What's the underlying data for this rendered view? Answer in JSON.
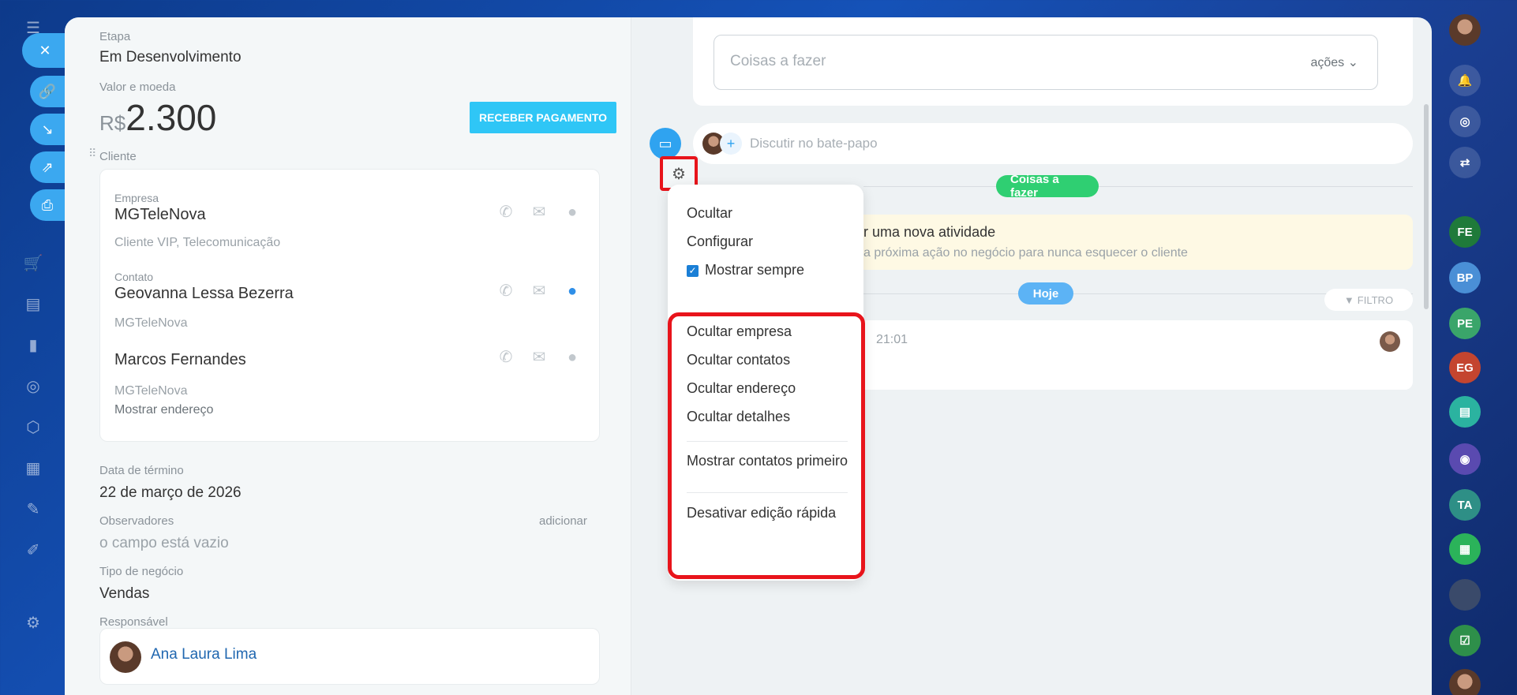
{
  "left_panel": {
    "stage_label": "Etapa",
    "stage_value": "Em Desenvolvimento",
    "amount_label": "Valor e moeda",
    "currency": "R$",
    "amount": "2.300",
    "pay_button": "RECEBER PAGAMENTO",
    "client_label": "Cliente",
    "client": {
      "company_label": "Empresa",
      "company_name": "MGTeleNova",
      "company_sub": "Cliente VIP, Telecomunicação",
      "contact_label": "Contato",
      "contact1_name": "Geovanna Lessa Bezerra",
      "contact1_sub": "MGTeleNova",
      "contact2_name": "Marcos Fernandes",
      "contact2_sub": "MGTeleNova",
      "show_address": "Mostrar endereço"
    },
    "end_date_label": "Data de término",
    "end_date_value": "22 de março de 2026",
    "observers_label": "Observadores",
    "observers_add": "adicionar",
    "observers_value": "o campo está vazio",
    "deal_type_label": "Tipo de negócio",
    "deal_type_value": "Vendas",
    "responsible_label": "Responsável",
    "responsible_name": "Ana Laura Lima"
  },
  "menu": {
    "items_top": [
      "Ocultar",
      "Configurar"
    ],
    "show_always": "Mostrar sempre",
    "items_highlight": [
      "Ocultar empresa",
      "Ocultar contatos",
      "Ocultar endereço",
      "Ocultar detalhes"
    ],
    "show_contacts_first": "Mostrar contatos primeiro",
    "disable_quick_edit": "Desativar edição rápida"
  },
  "timeline": {
    "todo_placeholder": "Coisas a fazer",
    "todo_actions": "ações",
    "chat_placeholder": "Discutir no bate-papo",
    "todo_badge": "Coisas a fazer",
    "activity_title": "r uma nova atividade",
    "activity_sub": "a próxima ação no negócio para nunca esquecer o cliente",
    "today_badge": "Hoje",
    "filter": "FILTRO",
    "history_time": "21:01"
  },
  "right_nav": {
    "avatars": [
      "FE",
      "BP",
      "PE",
      "EG",
      "TA"
    ]
  },
  "colors": {
    "accent": "#2fc6f6",
    "highlight": "#e8141b",
    "success": "#2fcf72",
    "today": "#5cb3f5"
  }
}
